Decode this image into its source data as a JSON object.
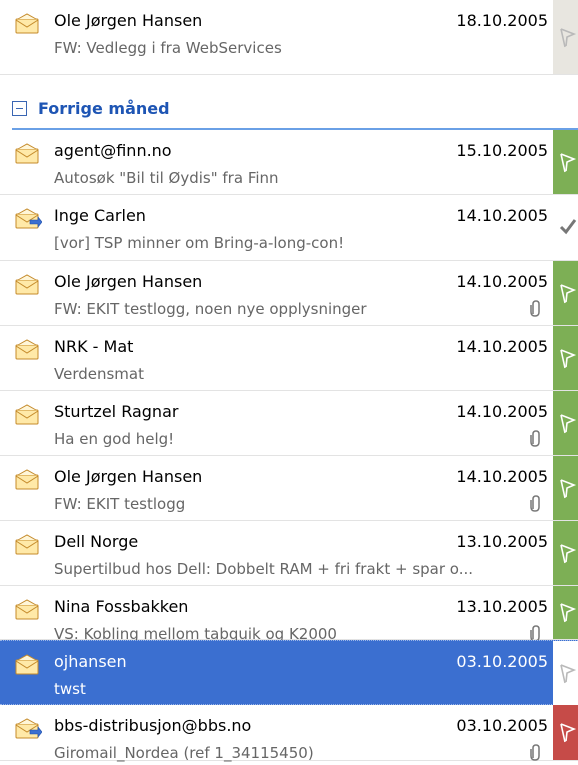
{
  "group": {
    "title": "Forrige måned"
  },
  "messages": [
    {
      "from": "Ole Jørgen Hansen",
      "subject": "FW: Vedlegg i fra WebServices",
      "date": "18.10.2005",
      "icon": "envelope-open-icon",
      "attachment": false,
      "flag": "flag-outline-icon",
      "flag_bg": "#e8e6e0"
    },
    {
      "from": "agent@finn.no",
      "subject": "Autosøk \"Bil til Øydis\" fra Finn",
      "date": "15.10.2005",
      "icon": "envelope-open-icon",
      "attachment": false,
      "flag": "flag-green-icon",
      "flag_bg": "#7daf55"
    },
    {
      "from": "Inge Carlen",
      "subject": "[vor] TSP minner om Bring-a-long-con!",
      "date": "14.10.2005",
      "icon": "envelope-reply-icon",
      "attachment": false,
      "flag": "check-icon",
      "flag_bg": "#ffffff"
    },
    {
      "from": "Ole Jørgen Hansen",
      "subject": "FW: EKIT testlogg, noen nye opplysninger",
      "date": "14.10.2005",
      "icon": "envelope-open-icon",
      "attachment": true,
      "flag": "flag-green-icon",
      "flag_bg": "#7daf55"
    },
    {
      "from": "NRK -  Mat",
      "subject": "Verdensmat",
      "date": "14.10.2005",
      "icon": "envelope-open-icon",
      "attachment": false,
      "flag": "flag-green-icon",
      "flag_bg": "#7daf55"
    },
    {
      "from": "Sturtzel Ragnar",
      "subject": "Ha en god helg!",
      "date": "14.10.2005",
      "icon": "envelope-open-icon",
      "attachment": true,
      "flag": "flag-green-icon",
      "flag_bg": "#7daf55"
    },
    {
      "from": "Ole Jørgen Hansen",
      "subject": "FW: EKIT testlogg",
      "date": "14.10.2005",
      "icon": "envelope-open-icon",
      "attachment": true,
      "flag": "flag-green-icon",
      "flag_bg": "#7daf55"
    },
    {
      "from": "Dell Norge",
      "subject": "Supertilbud hos Dell: Dobbelt RAM + fri frakt + spar o...",
      "date": "13.10.2005",
      "icon": "envelope-open-icon",
      "attachment": false,
      "flag": "flag-green-icon",
      "flag_bg": "#7daf55"
    },
    {
      "from": "Nina Fossbakken",
      "subject": "VS: Kobling mellom tabquik og K2000",
      "date": "13.10.2005",
      "icon": "envelope-open-icon",
      "attachment": true,
      "flag": "flag-green-icon",
      "flag_bg": "#7daf55"
    },
    {
      "from": "ojhansen",
      "subject": "twst",
      "date": "03.10.2005",
      "icon": "envelope-open-icon",
      "attachment": false,
      "flag": "flag-outline-icon",
      "flag_bg": "#ffffff",
      "selected": true
    },
    {
      "from": "bbs-distribusjon@bbs.no",
      "subject": "Giromail_Nordea (ref 1_34115450)",
      "date": "03.10.2005",
      "icon": "envelope-reply-icon",
      "attachment": true,
      "flag": "flag-red-icon",
      "flag_bg": "#c64b48"
    }
  ]
}
